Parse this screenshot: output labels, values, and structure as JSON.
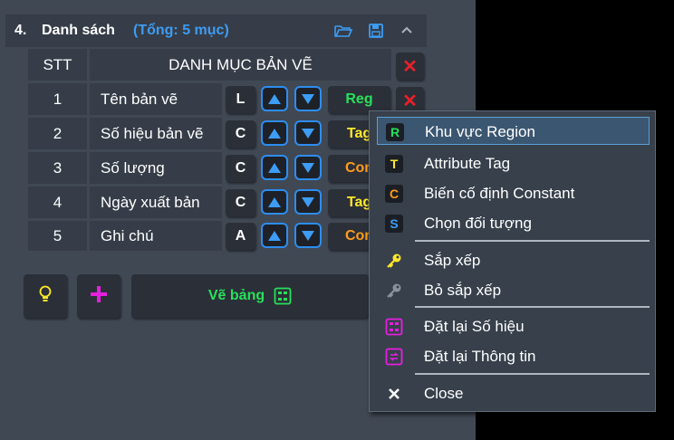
{
  "header": {
    "number": "4.",
    "title": "Danh sách",
    "total": "(Tổng: 5 mục)",
    "icons": [
      "folder-open-icon",
      "save-icon",
      "chevron-up-icon"
    ]
  },
  "table": {
    "columns": [
      "STT",
      "DANH MỤC BẢN VẼ"
    ],
    "rows": [
      {
        "stt": "1",
        "name": "Tên bản vẽ",
        "type": "L",
        "tag": "Reg",
        "tag_color": "#27e05a"
      },
      {
        "stt": "2",
        "name": "Số hiệu bản vẽ",
        "type": "C",
        "tag": "Tag",
        "tag_color": "#ffe82a"
      },
      {
        "stt": "3",
        "name": "Số lượng",
        "type": "C",
        "tag": "Con",
        "tag_color": "#ff9c1a"
      },
      {
        "stt": "4",
        "name": "Ngày xuất bản",
        "type": "C",
        "tag": "Tag",
        "tag_color": "#ffe82a"
      },
      {
        "stt": "5",
        "name": "Ghi chú",
        "type": "A",
        "tag": "Con",
        "tag_color": "#ff9c1a"
      }
    ]
  },
  "bottom": {
    "draw_label": "Vẽ bảng",
    "icons": [
      "lightbulb-icon",
      "plus-icon",
      "table-icon"
    ]
  },
  "menu": {
    "items": [
      {
        "label": "Khu vực Region",
        "icon": "R",
        "icon_color": "#27e05a"
      },
      {
        "label": "Attribute Tag",
        "icon": "T",
        "icon_color": "#ffe82a"
      },
      {
        "label": "Biến cố định Constant",
        "icon": "C",
        "icon_color": "#ff9c1a"
      },
      {
        "label": "Chọn đối tượng",
        "icon": "S",
        "icon_color": "#3d9cf4"
      },
      {
        "label": "Sắp xếp",
        "icon": "key-icon"
      },
      {
        "label": "Bỏ sắp xếp",
        "icon": "key-gray-icon"
      },
      {
        "label": "Đặt lại Số hiệu",
        "icon": "renumber-icon"
      },
      {
        "label": "Đặt lại Thông tin",
        "icon": "reset-info-icon"
      },
      {
        "label": "Close",
        "icon": "close-icon"
      }
    ],
    "selected_index": 0
  }
}
